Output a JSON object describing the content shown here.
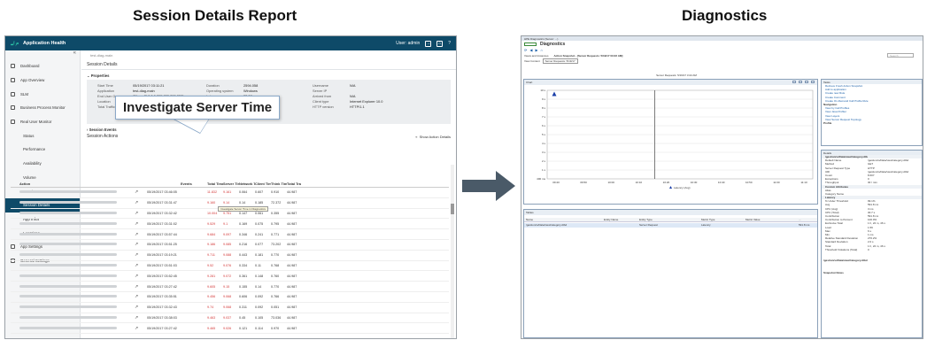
{
  "headings": {
    "left": "Session Details Report",
    "right": "Diagnostics"
  },
  "left_app": {
    "app_title": "Application Health",
    "user_label": "User: admin",
    "collapse_glyph": "«",
    "breadcrumb": "test-diag-main",
    "page_title": "Session Details",
    "sidebar": [
      {
        "label": "Dashboard",
        "icon": "home-icon",
        "sub": false,
        "active": false
      },
      {
        "label": "App Overview",
        "icon": "overview-icon",
        "sub": false,
        "active": false
      },
      {
        "label": "SLM",
        "icon": "slm-icon",
        "sub": false,
        "active": false
      },
      {
        "label": "Business Process Monitor",
        "icon": "bpm-icon",
        "sub": false,
        "active": false
      },
      {
        "label": "Real User Monitor",
        "icon": "rum-icon",
        "sub": false,
        "active": false
      },
      {
        "label": "Status",
        "sub": true,
        "active": false
      },
      {
        "label": "Performance",
        "sub": true,
        "active": false
      },
      {
        "label": "Availability",
        "sub": true,
        "active": false
      },
      {
        "label": "Volume",
        "sub": true,
        "active": false
      },
      {
        "label": "Sessions",
        "sub": true,
        "active": false
      },
      {
        "label": "Session Details",
        "sub": true,
        "active": true
      },
      {
        "label": "App Infra",
        "sub": true,
        "active": false
      },
      {
        "label": "Locations",
        "sub": true,
        "active": false
      },
      {
        "label": "App Settings",
        "icon": "settings-icon",
        "sub": false,
        "active": false
      },
      {
        "label": "General Settings",
        "icon": "general-settings-icon",
        "sub": false,
        "active": false
      }
    ],
    "properties_header": "Properties",
    "properties": {
      "col1": [
        [
          "Start Time",
          "05/19/2017 03:11:21"
        ],
        [
          "Application",
          "test-diag-main"
        ],
        [
          "End User Group",
          "Others [0.0.0.0-255.255.255.255]"
        ],
        [
          "Location",
          "United Kingdom"
        ],
        [
          "Total Traffic",
          "51,776.8"
        ]
      ],
      "col2": [
        [
          "Duration",
          "2594.058"
        ],
        [
          "Operating system",
          "Windows"
        ],
        [
          "Latency",
          "33.28"
        ],
        [
          "Client IP",
          "82.115.0.184"
        ],
        [
          "Client host name",
          "N/A"
        ]
      ],
      "col3": [
        [
          "Username",
          "N/A"
        ],
        [
          "Server IP",
          ""
        ],
        [
          "Arrived from",
          "N/A"
        ],
        [
          "Client type",
          "Internet Explorer 10.0"
        ],
        [
          "HTTP version",
          "HTTP/1.1"
        ]
      ]
    },
    "events_header": "Session Events",
    "events_sub": "Session Actions",
    "show_action_details": "Show Action Details",
    "callout": "Investigate Server Time",
    "tiny_tip": "Investigate Server Time in Diagnostics",
    "columns": [
      "Action",
      "",
      "",
      "Events",
      "Total Time",
      "Server Time",
      "Network Time",
      "Client Time",
      "Think Time",
      "Total Tra"
    ],
    "rows": [
      [
        "05/19/2017",
        "03:46:05",
        "",
        "11.832",
        "9.161",
        "0.064",
        "0.607",
        "0.910",
        "44.987"
      ],
      [
        "05/19/2017",
        "03:31:47",
        "",
        "9.160",
        "9.14",
        "0.14",
        "0.185",
        "72.372",
        "44.987"
      ],
      [
        "05/19/2017",
        "03:32:42",
        "",
        "10.004",
        "9.751",
        "0.147",
        "0.061",
        "0.355",
        "44.987"
      ],
      [
        "05/19/2017",
        "03:31:02",
        "",
        "9.529",
        "9.1",
        "0.169",
        "0.075",
        "0.795",
        "44.987"
      ],
      [
        "05/19/2017",
        "03:57:44",
        "",
        "9.684",
        "9.097",
        "0.346",
        "0.241",
        "0.771",
        "44.987"
      ],
      [
        "05/19/2017",
        "03:51:25",
        "",
        "9.186",
        "9.085",
        "0.216",
        "0.077",
        "73.202",
        "44.987"
      ],
      [
        "05/19/2017",
        "03:19:21",
        "",
        "9.711",
        "9.088",
        "0.443",
        "0.181",
        "0.770",
        "44.987"
      ],
      [
        "05/19/2017",
        "03:51:03",
        "",
        "9.52",
        "9.076",
        "0.334",
        "0.11",
        "0.768",
        "44.987"
      ],
      [
        "05/19/2017",
        "03:52:45",
        "",
        "9.281",
        "9.072",
        "0.361",
        "0.148",
        "0.760",
        "44.987"
      ],
      [
        "05/19/2017",
        "03:27:42",
        "",
        "9.605",
        "9.15",
        "0.155",
        "0.14",
        "0.770",
        "44.987"
      ],
      [
        "05/19/2017",
        "03:35:51",
        "",
        "9.456",
        "9.068",
        "0.606",
        "0.092",
        "0.766",
        "44.987"
      ],
      [
        "05/19/2017",
        "03:32:43",
        "",
        "9.74",
        "9.068",
        "0.311",
        "0.092",
        "0.051",
        "44.987"
      ],
      [
        "05/19/2017",
        "03:38:03",
        "",
        "9.463",
        "9.037",
        "0.45",
        "0.105",
        "73.036",
        "44.987"
      ],
      [
        "05/19/2017",
        "03:27:42",
        "",
        "9.465",
        "9.026",
        "0.121",
        "0.114",
        "0.970",
        "44.987"
      ]
    ]
  },
  "right_app": {
    "titlebar": "HPE Diagnostics (Server: ...)",
    "app_name": "Diagnostics",
    "search_placeholder": "Search",
    "tabs": [
      "Views and Instances",
      "Action Snapshot - [Server Requests: 5/19/17 03:22 AM]"
    ],
    "view_context_label": "View Context",
    "view_context_value": "Server Requests: 5/19/17",
    "chart_title": "Server Requests: 5/19/17 3:22 AM",
    "chart_panel_title": "Chart",
    "chart_legend": "Latency (Avg)",
    "chart_color": "#1a3fa8",
    "table_panel_title": "Tables",
    "table_columns": [
      "Name",
      "Entity Name",
      "Entity Type",
      "Metric Type",
      "Metric Value",
      "..."
    ],
    "table_row": [
      "/gestion/svData/viewCategory.dtbd",
      "Server Request",
      "Latency",
      "591.8 ms"
    ],
    "tasks_title": "Tasks",
    "tasks": [
      "Retrieve Fresh Action Snapshot",
      "Add to application",
      "Create new Rule",
      "Create Comment",
      "Create On-Demand Call Profile Rule"
    ],
    "navigation_title": "Navigation",
    "nav_items": [
      "View by Call Profiles",
      "View Java Profiler",
      "View Layers",
      "View Server Request Topology"
    ],
    "profile_label": "Profile",
    "details_title": "Details",
    "details": [
      {
        "k": "/gestion/svData/viewCategory.dtbd",
        "v": "",
        "group": true
      },
      {
        "k": "Default Name",
        "v": "/gestion/svData/viewCategory.dtbd",
        "group": false
      },
      {
        "k": "Method",
        "v": "GET",
        "group": false
      },
      {
        "k": "Server Request Type",
        "v": "HTTP",
        "group": false
      },
      {
        "k": "URI",
        "v": "/gestion/svData/viewCategory.dtbd",
        "group": false
      },
      {
        "k": "Count",
        "v": "8.607",
        "group": false
      },
      {
        "k": "Exceptions",
        "v": "0",
        "group": false
      },
      {
        "k": "Throughput",
        "v": "30 / min",
        "group": false
      },
      {
        "k": "Custom Attributes",
        "v": "",
        "group": true
      },
      {
        "k": "Alias",
        "v": "",
        "group": false
      },
      {
        "k": "Category Name",
        "v": "",
        "group": false
      },
      {
        "k": "Latency",
        "v": "",
        "group": true
      },
      {
        "k": "% Under Threshold",
        "v": "99.1%",
        "group": false
      },
      {
        "k": "Avg",
        "v": "591.8 ms",
        "group": false
      },
      {
        "k": "CPU (Avg)",
        "v": "3 ms",
        "group": false
      },
      {
        "k": "CPU (Total)",
        "v": "30.7 s",
        "group": false
      },
      {
        "k": "Contribution",
        "v": "591.8 ms",
        "group": false
      },
      {
        "k": "Contribution to Percent",
        "v": "100.0%",
        "group": false
      },
      {
        "k": "Exclusive Total",
        "v": "1 h, 22 m, 46 s",
        "group": false
      },
      {
        "k": "Load",
        "v": "1.59",
        "group": false
      },
      {
        "k": "Max",
        "v": "6 s",
        "group": false
      },
      {
        "k": "Min",
        "v": "1 ms",
        "group": false
      },
      {
        "k": "Relative Standard Deviation",
        "v": "276.2%",
        "group": false
      },
      {
        "k": "Standard Deviation",
        "v": "2.0 s",
        "group": false
      },
      {
        "k": "Total",
        "v": "1 h, 22 m, 46 s",
        "group": false
      },
      {
        "k": "Threshold Violations (Total)",
        "v": "0",
        "group": false
      }
    ],
    "footer_path": "/gestion/svData/viewCategory.dtbd",
    "snapshot_notes": "Snapshot Notes"
  },
  "chart_data": {
    "type": "line",
    "title": "Server Requests: 5/19/17 3:22 AM",
    "x": [
      "09:40",
      "09:50",
      "10:00",
      "10:10",
      "10:20",
      "10:30",
      "10:40",
      "10:50",
      "11:00",
      "11:10"
    ],
    "y_ticks": [
      "400 ms",
      "1 s",
      "2 s",
      "3 s",
      "4 s",
      "5 s",
      "6 s",
      "7 s",
      "8 s",
      "9 s",
      "10 s"
    ],
    "series": [
      {
        "name": "Latency (Avg)",
        "marker": "triangle",
        "values": [
          9.6
        ]
      }
    ],
    "ylim": [
      0,
      10
    ],
    "grid": true,
    "legend": "bottom-center"
  },
  "colors": {
    "left_header": "#0e4a68",
    "accent": "#2bc4a6",
    "red_value": "#d43b3b",
    "arrow": "#4a5a68",
    "right_link": "#1a5fa8"
  }
}
